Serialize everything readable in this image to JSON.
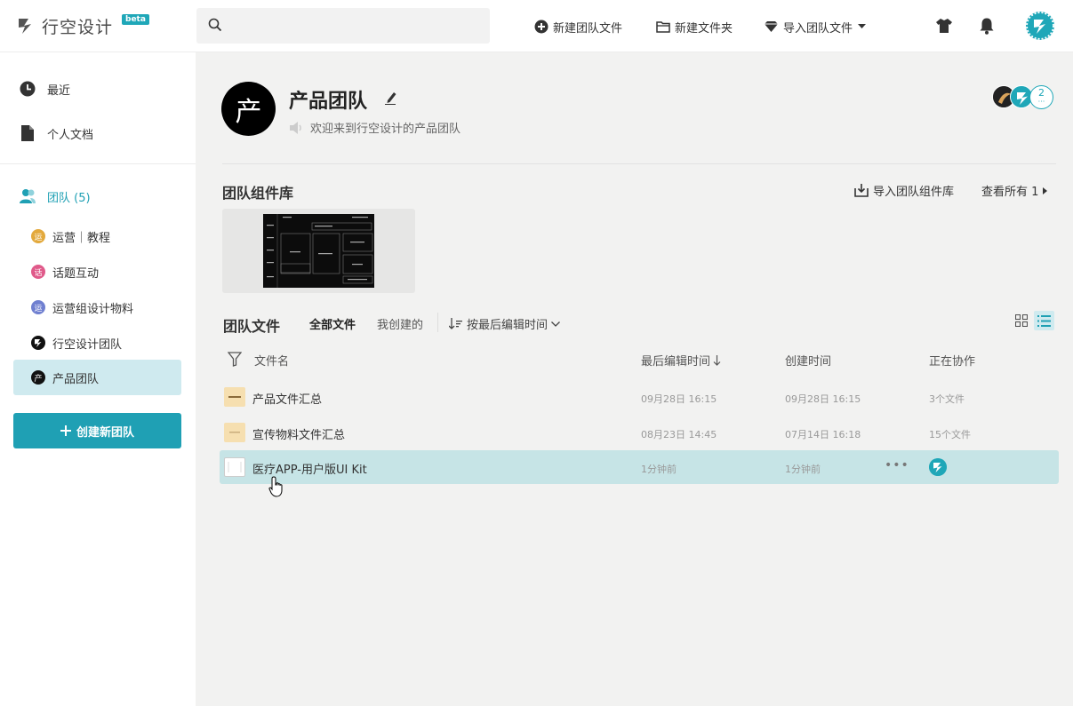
{
  "app": {
    "logo_text": "行空设计",
    "logo_badge": "beta",
    "brand_color": "#1fa7b8"
  },
  "topbar": {
    "search_placeholder": "",
    "new_team_file": "新建团队文件",
    "new_folder": "新建文件夹",
    "import_team_file": "导入团队文件",
    "icons": [
      "shirt-icon",
      "bell-icon",
      "avatar"
    ]
  },
  "sidebar": {
    "recent": "最近",
    "personal_docs": "个人文档",
    "teams_label": "团队 (5)",
    "teams": [
      {
        "label": "运营｜教程",
        "badge": "运",
        "color": "#e3a93c"
      },
      {
        "label": "话题互动",
        "badge": "话",
        "color": "#e05a8a"
      },
      {
        "label": "运营组设计物料",
        "badge": "运",
        "color": "#6f7fd0"
      },
      {
        "label": "行空设计团队",
        "badge": "",
        "color": "#111111"
      },
      {
        "label": "产品团队",
        "badge": "产",
        "color": "#111111"
      }
    ],
    "create_team": "创建新团队"
  },
  "team": {
    "avatar_char": "产",
    "title": "产品团队",
    "welcome": "欢迎来到行空设计的产品团队",
    "member_more": "2"
  },
  "library": {
    "title": "团队组件库",
    "import_label": "导入团队组件库",
    "view_all": "查看所有 1"
  },
  "files": {
    "title": "团队文件",
    "tab_all": "全部文件",
    "tab_mine": "我创建的",
    "sort_label": "按最后编辑时间",
    "columns": {
      "name": "文件名",
      "edited": "最后编辑时间",
      "created": "创建时间",
      "collab": "正在协作"
    },
    "rows": [
      {
        "name": "产品文件汇总",
        "edited": "09月28日 16:15",
        "created": "09月28日 16:15",
        "collab": "3个文件",
        "thumb_color": "#f6dfb0"
      },
      {
        "name": "宣传物料文件汇总",
        "edited": "08月23日 14:45",
        "created": "07月14日 16:18",
        "collab": "15个文件",
        "thumb_color": "#f6dfb0"
      },
      {
        "name": "医疗APP-用户版UI Kit",
        "edited": "1分钟前",
        "created": "1分钟前",
        "collab": "",
        "thumb_color": "#ffffff"
      }
    ]
  }
}
